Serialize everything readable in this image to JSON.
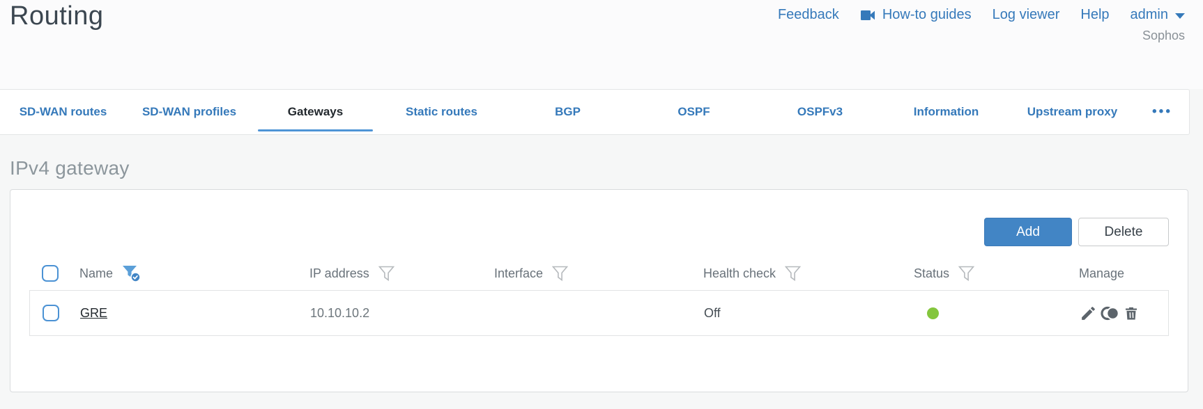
{
  "page": {
    "title": "Routing",
    "brand": "Sophos"
  },
  "topnav": {
    "feedback": "Feedback",
    "howto_guides": "How-to guides",
    "log_viewer": "Log viewer",
    "help": "Help",
    "user": "admin"
  },
  "tabs": {
    "items": [
      {
        "label": "SD-WAN routes",
        "active": false
      },
      {
        "label": "SD-WAN profiles",
        "active": false
      },
      {
        "label": "Gateways",
        "active": true
      },
      {
        "label": "Static routes",
        "active": false
      },
      {
        "label": "BGP",
        "active": false
      },
      {
        "label": "OSPF",
        "active": false
      },
      {
        "label": "OSPFv3",
        "active": false
      },
      {
        "label": "Information",
        "active": false
      },
      {
        "label": "Upstream proxy",
        "active": false
      }
    ],
    "overflow": "•••"
  },
  "section": {
    "heading": "IPv4 gateway"
  },
  "toolbar": {
    "add": "Add",
    "delete": "Delete"
  },
  "table": {
    "columns": [
      {
        "label": "Name",
        "filter": "active"
      },
      {
        "label": "IP address",
        "filter": "inactive"
      },
      {
        "label": "Interface",
        "filter": "inactive"
      },
      {
        "label": "Health check",
        "filter": "inactive"
      },
      {
        "label": "Status",
        "filter": "inactive"
      },
      {
        "label": "Manage",
        "filter": "none"
      }
    ],
    "rows": [
      {
        "name": "GRE",
        "ip_address": "10.10.10.2",
        "interface": "",
        "health_check": "Off",
        "status": "up",
        "status_color": "#84c63d",
        "actions": [
          "edit",
          "clone",
          "delete"
        ]
      }
    ]
  },
  "icons": {
    "howto": "video-camera-icon",
    "user_menu": "chevron-down-icon",
    "tab_overflow": "ellipsis-icon",
    "filter": "funnel-icon",
    "filter_active": "funnel-check-icon",
    "edit": "pencil-icon",
    "clone": "clone-icon",
    "delete": "trash-icon"
  },
  "colors": {
    "link_blue": "#3579ba",
    "button_blue": "#4285c5",
    "status_green": "#84c63d",
    "title_gray": "#3b4650",
    "heading_gray": "#8c969c"
  }
}
